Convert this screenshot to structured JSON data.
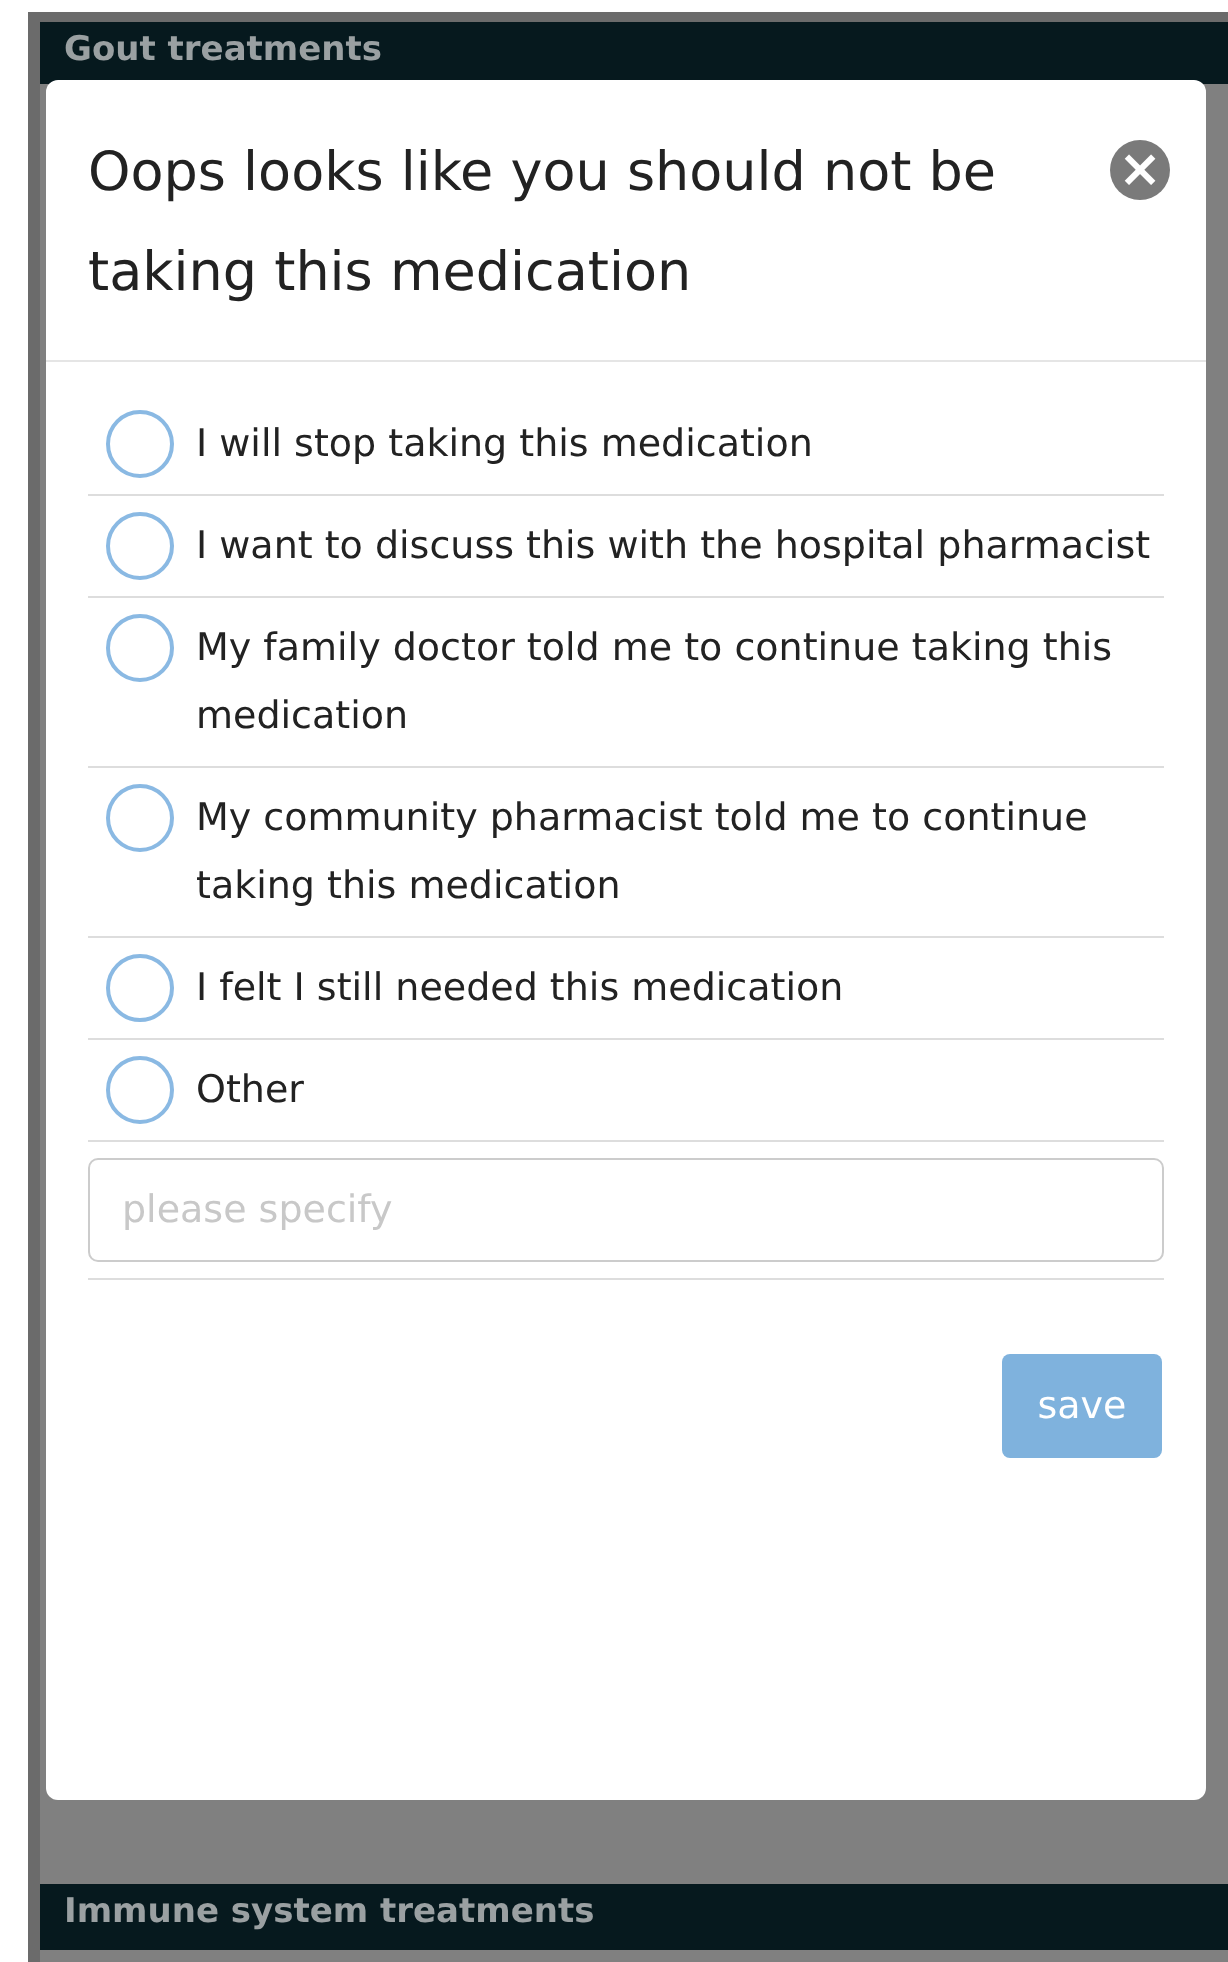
{
  "header_bar": {
    "title": "Gout treatments"
  },
  "modal": {
    "title": "Oops looks like you should not be taking this medication",
    "close_icon": "×",
    "options": [
      {
        "label": "I will stop taking this medication",
        "selected": false
      },
      {
        "label": "I want to discuss this with the hospital pharmacist",
        "selected": false
      },
      {
        "label": "My family doctor told me to continue taking this medication",
        "selected": false
      },
      {
        "label": "My community pharmacist told me to continue taking this medication",
        "selected": false
      },
      {
        "label": "I felt I still needed this medication",
        "selected": false
      },
      {
        "label": "Other",
        "selected": false
      }
    ],
    "other_field": {
      "placeholder": "please specify"
    },
    "save_button": {
      "label": "save",
      "disabled": true
    }
  },
  "footer_bar": {
    "title": "Immune system treatments"
  }
}
